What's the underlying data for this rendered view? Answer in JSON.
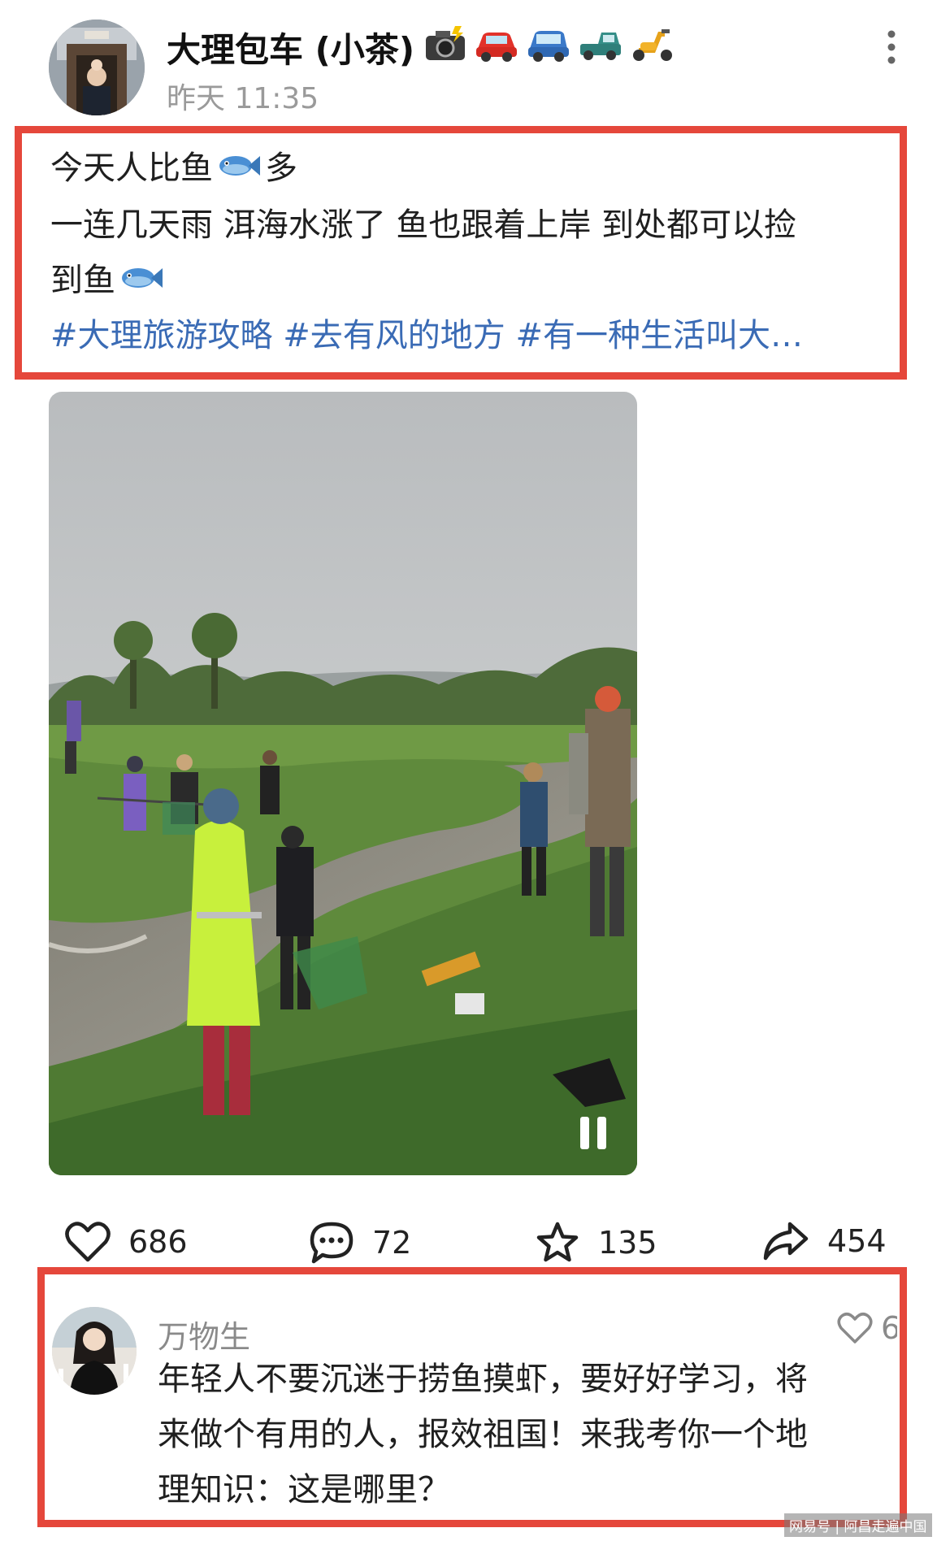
{
  "post": {
    "author": "大理包车 (小茶)",
    "author_emojis": [
      "camera-flash",
      "red-car",
      "blue-car",
      "pickup-truck",
      "scooter"
    ],
    "time": "昨天 11:35",
    "text_line1": "今天人比鱼",
    "text_line1_tail": "多",
    "text_line2": "一连几天雨 洱海水涨了 鱼也跟着上岸 到处都可以捡",
    "text_line3": "到鱼",
    "tags": "#大理旅游攻略 #去有风的地方 #有一种生活叫大…"
  },
  "video": {
    "paused": false,
    "control_icon": "pause-icon"
  },
  "actions": {
    "likes": "686",
    "comments": "72",
    "favorites": "135",
    "shares": "454"
  },
  "comment": {
    "author": "万物生",
    "like_count": "6",
    "line1": "年轻人不要沉迷于捞鱼摸虾，要好好学习，将",
    "line2": "来做个有用的人，报效祖国！来我考你一个地",
    "line3": "理知识：这是哪里？"
  },
  "watermark": "网易号 | 阿昌走遍中国",
  "colors": {
    "highlight_border": "#e5473b",
    "hashtag": "#3a6bb5",
    "muted_text": "#9a9a9a"
  }
}
